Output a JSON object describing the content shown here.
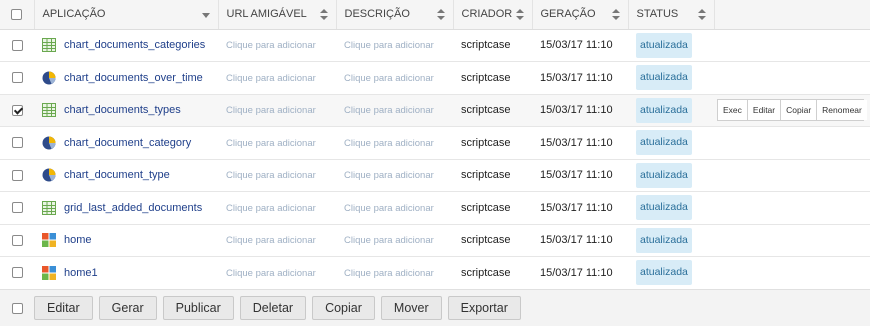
{
  "columns": {
    "application": "APLICAÇÃO",
    "url": "URL AMIGÁVEL",
    "description": "DESCRIÇÃO",
    "creator": "CRIADOR",
    "generation": "GERAÇÃO",
    "status": "STATUS"
  },
  "rows": [
    {
      "name": "chart_documents_categories",
      "icon": "grid-icon",
      "url": "Clique para adicionar",
      "description": "Clique para adicionar",
      "creator": "scriptcase",
      "date": "15/03/17 11:10",
      "status": "atualizada",
      "checked": false
    },
    {
      "name": "chart_documents_over_time",
      "icon": "pie-chart-icon",
      "url": "Clique para adicionar",
      "description": "Clique para adicionar",
      "creator": "scriptcase",
      "date": "15/03/17 11:10",
      "status": "atualizada",
      "checked": false
    },
    {
      "name": "chart_documents_types",
      "icon": "grid-icon",
      "url": "Clique para adicionar",
      "description": "Clique para adicionar",
      "creator": "scriptcase",
      "date": "15/03/17 11:10",
      "status": "atualizada",
      "checked": true
    },
    {
      "name": "chart_document_category",
      "icon": "pie-chart-icon",
      "url": "Clique para adicionar",
      "description": "Clique para adicionar",
      "creator": "scriptcase",
      "date": "15/03/17 11:10",
      "status": "atualizada",
      "checked": false
    },
    {
      "name": "chart_document_type",
      "icon": "pie-chart-icon",
      "url": "Clique para adicionar",
      "description": "Clique para adicionar",
      "creator": "scriptcase",
      "date": "15/03/17 11:10",
      "status": "atualizada",
      "checked": false
    },
    {
      "name": "grid_last_added_documents",
      "icon": "grid-icon",
      "url": "Clique para adicionar",
      "description": "Clique para adicionar",
      "creator": "scriptcase",
      "date": "15/03/17 11:10",
      "status": "atualizada",
      "checked": false
    },
    {
      "name": "home",
      "icon": "menu-tiles-icon",
      "url": "Clique para adicionar",
      "description": "Clique para adicionar",
      "creator": "scriptcase",
      "date": "15/03/17 11:10",
      "status": "atualizada",
      "checked": false
    },
    {
      "name": "home1",
      "icon": "menu-tiles-icon",
      "url": "Clique para adicionar",
      "description": "Clique para adicionar",
      "creator": "scriptcase",
      "date": "15/03/17 11:10",
      "status": "atualizada",
      "checked": false
    }
  ],
  "row_actions": {
    "row_index": 2,
    "buttons": [
      "Exec",
      "Editar",
      "Copiar",
      "Renomear"
    ]
  },
  "footer": {
    "buttons": [
      "Editar",
      "Gerar",
      "Publicar",
      "Deletar",
      "Copiar",
      "Mover",
      "Exportar"
    ]
  }
}
